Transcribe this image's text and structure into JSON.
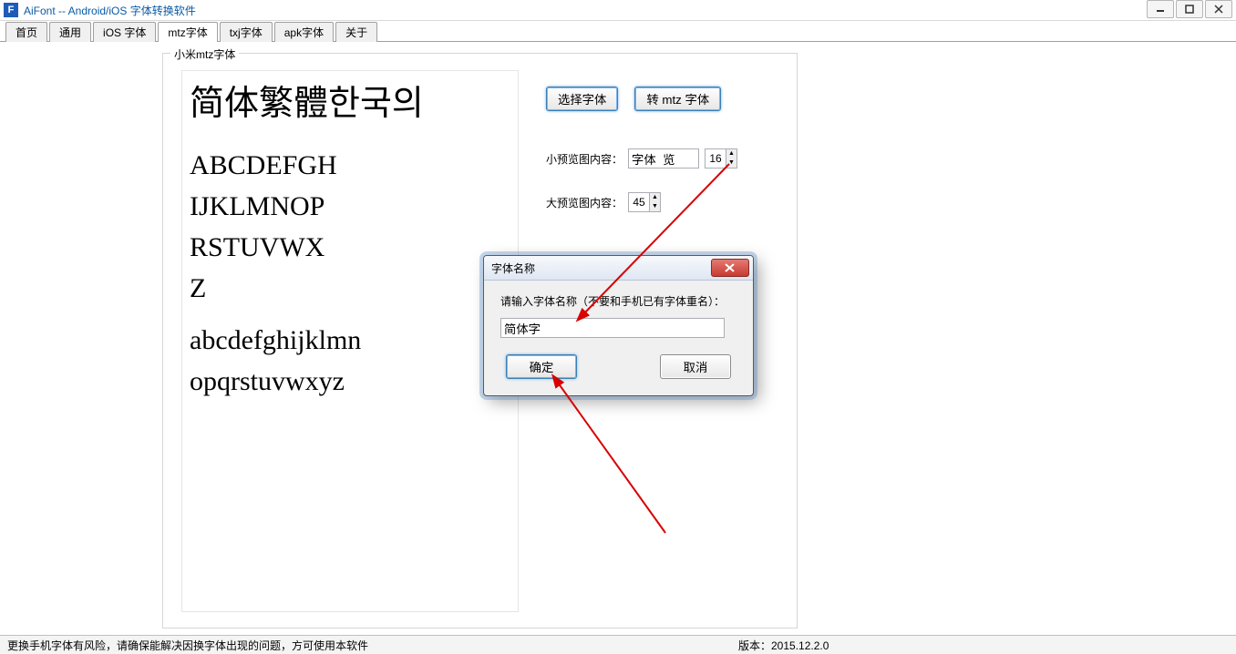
{
  "window": {
    "app_icon_letter": "F",
    "title": "AiFont -- Android/iOS 字体转换软件"
  },
  "tabs": [
    "首页",
    "通用",
    "iOS 字体",
    "mtz字体",
    "txj字体",
    "apk字体",
    "关于"
  ],
  "active_tab_index": 3,
  "group": {
    "legend": "小米mtz字体",
    "buttons": {
      "select_font": "选择字体",
      "convert_mtz": "转 mtz 字体"
    },
    "small_preview_label": "小预览图内容：",
    "small_preview_value": "字体  览",
    "small_preview_size": "16",
    "big_preview_label": "大预览图内容：",
    "big_preview_size": "45",
    "preview_text_cjk": "简体繁體한국의",
    "preview_text_upper1": "ABCDEFGH",
    "preview_text_upper2": "IJKLMNOP",
    "preview_text_upper3": "RSTUVWX",
    "preview_text_upper4": "Z",
    "preview_text_lower1": "abcdefghijklmn",
    "preview_text_lower2": "opqrstuvwxyz"
  },
  "dialog": {
    "title": "字体名称",
    "prompt": "请输入字体名称（不要和手机已有字体重名）：",
    "value": "简体字",
    "ok": "确定",
    "cancel": "取消"
  },
  "statusbar": {
    "message": "更换手机字体有风险，请确保能解决因换字体出现的问题，方可使用本软件",
    "version": "版本：2015.12.2.0"
  }
}
